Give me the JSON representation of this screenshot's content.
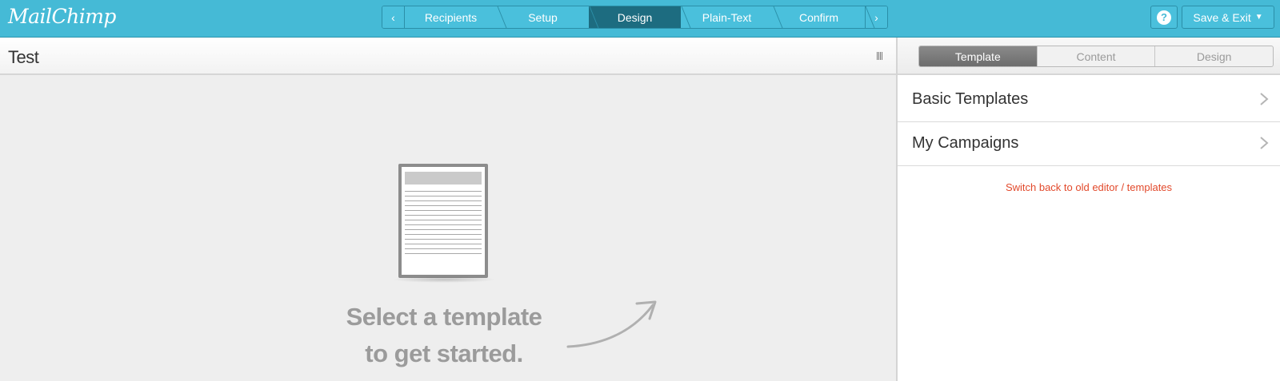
{
  "app": {
    "logo_text": "MailChimp"
  },
  "steps": {
    "items": [
      {
        "label": "Recipients",
        "active": false
      },
      {
        "label": "Setup",
        "active": false
      },
      {
        "label": "Design",
        "active": true
      },
      {
        "label": "Plain-Text",
        "active": false
      },
      {
        "label": "Confirm",
        "active": false
      }
    ],
    "prev_icon": "chevron-left-icon",
    "next_icon": "chevron-right-icon"
  },
  "header_actions": {
    "help_icon": "question-icon",
    "save_label": "Save & Exit",
    "save_caret": "▼"
  },
  "editor": {
    "title": "Test",
    "empty_state": {
      "line1": "Select a template",
      "line2": "to get started."
    }
  },
  "sidebar": {
    "tabs": [
      {
        "label": "Template",
        "active": true
      },
      {
        "label": "Content",
        "active": false
      },
      {
        "label": "Design",
        "active": false
      }
    ],
    "menu": [
      {
        "label": "Basic Templates"
      },
      {
        "label": "My Campaigns"
      }
    ],
    "switch_link": "Switch back to old editor / templates"
  },
  "colors": {
    "topbar": "#45bad6",
    "active_step": "#1d6c80",
    "link": "#e2492b",
    "active_tab": "#7a7a7a"
  }
}
